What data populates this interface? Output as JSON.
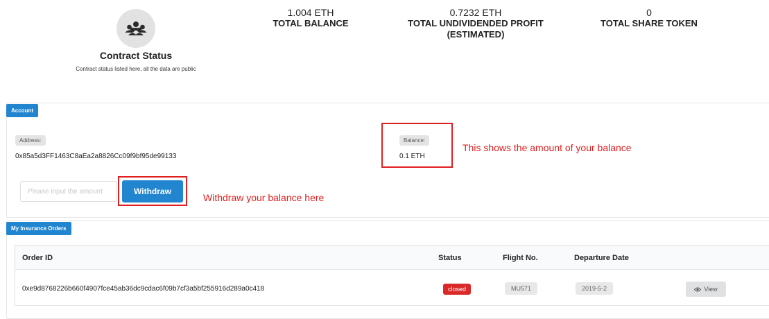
{
  "contract": {
    "title": "Contract Status",
    "subtitle": "Contract status listed here, all the data are public",
    "icon": "users-icon"
  },
  "stats": [
    {
      "value": "1.004 ETH",
      "label": "TOTAL BALANCE"
    },
    {
      "value": "0.7232 ETH",
      "label": "TOTAL UNDIVIDENDED PROFIT",
      "label2": "(ESTIMATED)"
    },
    {
      "value": "0",
      "label": "TOTAL SHARE TOKEN"
    }
  ],
  "account": {
    "tab_label": "Account",
    "address_label": "Address:",
    "address_value": "0x85a5d3FF1463C8aEa2a8826Cc09f9bf95de99133",
    "balance_label": "Balance:",
    "balance_value": "0.1 ETH",
    "amount_placeholder": "Please input the amount",
    "amount_value": "",
    "withdraw_label": "Withdraw"
  },
  "annotations": {
    "balance_note": "This shows the amount of your balance",
    "withdraw_note": "Withdraw your balance here"
  },
  "orders": {
    "tab_label": "My Insurance Orders",
    "columns": [
      "Order ID",
      "Status",
      "Flight No.",
      "Departure Date"
    ],
    "rows": [
      {
        "order_id": "0xe9d8768226b660f4907fce45ab36dc9cdac6f09b7cf3a5bf255916d289a0c418",
        "status": "closed",
        "flight_no": "MU571",
        "departure_date": "2019-5-2",
        "action_label": "View"
      }
    ]
  },
  "colors": {
    "primary": "#2185d0",
    "annotation_red": "#e02020",
    "closed_red": "#db2828"
  }
}
